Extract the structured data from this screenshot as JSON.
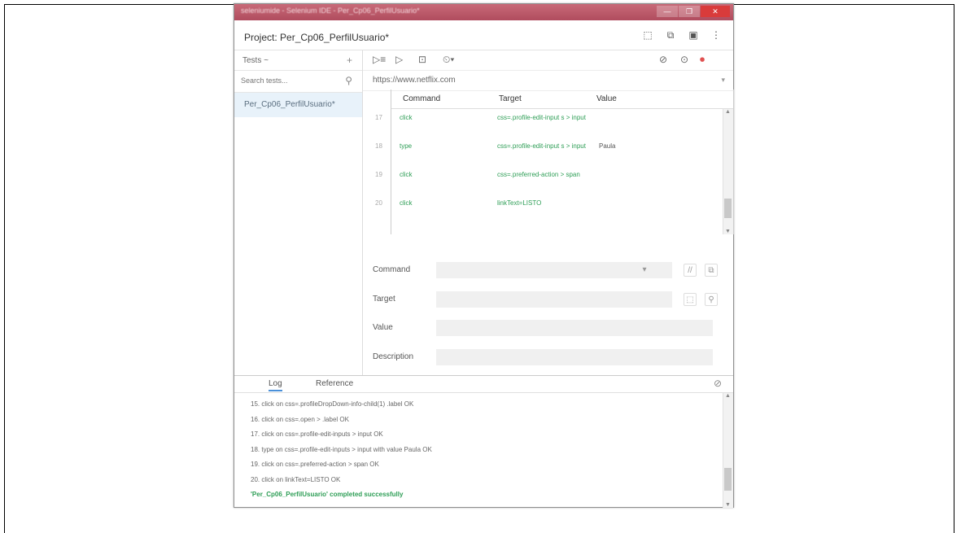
{
  "window": {
    "title": "seleniumide - Selenium IDE - Per_Cp06_PerfilUsuario*",
    "controls": [
      "—",
      "❐",
      "✕"
    ]
  },
  "project": {
    "title": "Project: Per_Cp06_PerfilUsuario*"
  },
  "sidebar": {
    "tests_label": "Tests ~",
    "add_label": "+",
    "search_placeholder": "Search tests...",
    "items": [
      {
        "label": "Per_Cp06_PerfilUsuario*"
      }
    ]
  },
  "toolbar": {
    "run_all": "▷≡",
    "run": "▷",
    "pause": "⊡",
    "speed": "⏲▾",
    "disable_breakpoints": "⊘",
    "record": "⏺"
  },
  "url": {
    "value": "https://www.netflix.com"
  },
  "table": {
    "headers": {
      "command": "Command",
      "target": "Target",
      "value": "Value"
    },
    "rows": [
      {
        "num": "17",
        "command": "click",
        "target": "css=.profile-edit-input s > input",
        "value": ""
      },
      {
        "num": "18",
        "command": "type",
        "target": "css=.profile-edit-input s > input",
        "value": "Paula"
      },
      {
        "num": "19",
        "command": "click",
        "target": "css=.preferred-action > span",
        "value": ""
      },
      {
        "num": "20",
        "command": "click",
        "target": "linkText=LISTO",
        "value": ""
      }
    ]
  },
  "editor": {
    "command_label": "Command",
    "target_label": "Target",
    "value_label": "Value",
    "description_label": "Description"
  },
  "log": {
    "tabs": [
      "Log",
      "Reference"
    ],
    "lines": [
      "15. click on css=.profileDropDown-info-child(1) .label OK",
      "16. click on css=.open > .label OK",
      "17. click on css=.profile-edit-inputs > input OK",
      "18. type on css=.profile-edit-inputs > input with value Paula OK",
      "19. click on css=.preferred-action > span OK",
      "20. click on linkText=LISTO OK"
    ],
    "success": "'Per_Cp06_PerfilUsuario' completed successfully"
  }
}
